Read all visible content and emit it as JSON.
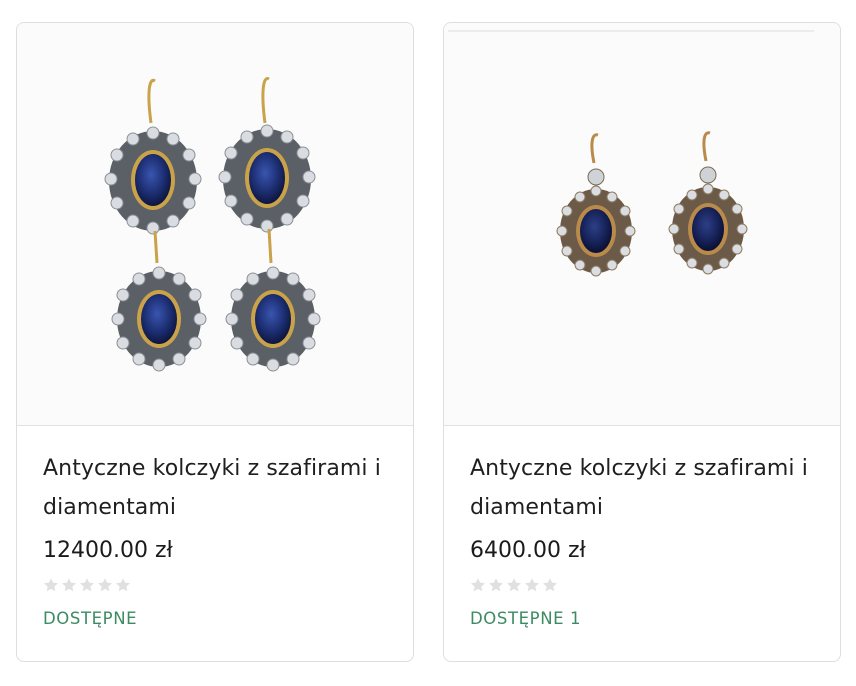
{
  "products": [
    {
      "title": "Antyczne kolczyki z szafirami i diamentami",
      "price": "12400.00 zł",
      "rating": 0,
      "rating_max": 5,
      "stock": "DOSTĘPNE",
      "image_icon": "double-drop-sapphire-earrings-image"
    },
    {
      "title": "Antyczne kolczyki z szafirami i diamentami",
      "price": "6400.00 zł",
      "rating": 0,
      "rating_max": 5,
      "stock": "DOSTĘPNE  1",
      "image_icon": "single-sapphire-earrings-image"
    }
  ],
  "colors": {
    "stock": "#3d8a63",
    "star_empty": "#e0e0e0",
    "sapphire": "#1d2f73",
    "gold": "#c9a24a"
  }
}
